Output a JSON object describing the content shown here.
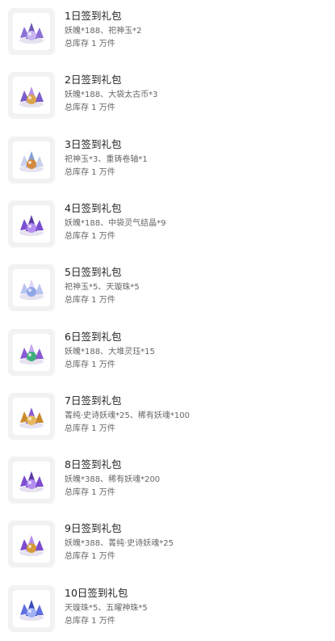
{
  "gifts": [
    {
      "title": "1日签到礼包",
      "desc": "妖魄*188、祀神玉*2",
      "stock": "总库存 1 万件",
      "icon": "purple-crystal-bundle-icon",
      "colors": [
        "#8e6fd6",
        "#c7b6f2",
        "#6d5bb8"
      ]
    },
    {
      "title": "2日签到礼包",
      "desc": "妖魄*188、大袋太古币*3",
      "stock": "总库存 1 万件",
      "icon": "purple-crystal-coin-bag-icon",
      "colors": [
        "#7e5cc9",
        "#d9a54a",
        "#b592e6"
      ]
    },
    {
      "title": "3日签到礼包",
      "desc": "祀神玉*3、重铸卷轴*1",
      "stock": "总库存 1 万件",
      "icon": "jade-scroll-bundle-icon",
      "colors": [
        "#c6d2ea",
        "#d48a3e",
        "#7fa0d8"
      ]
    },
    {
      "title": "4日签到礼包",
      "desc": "妖魄*188、中袋灵气结晶*9",
      "stock": "总库存 1 万件",
      "icon": "purple-crystal-pouch-icon",
      "colors": [
        "#7a4fd0",
        "#b48df0",
        "#5a3aa6"
      ]
    },
    {
      "title": "5日签到礼包",
      "desc": "祀神玉*5、天璇珠*5",
      "stock": "总库存 1 万件",
      "icon": "jade-pearl-bundle-icon",
      "colors": [
        "#b9c4f0",
        "#8fa6e8",
        "#e0d6f7"
      ]
    },
    {
      "title": "6日签到礼包",
      "desc": "妖魄*188、大堆灵珏*15",
      "stock": "总库存 1 万件",
      "icon": "purple-green-crystal-icon",
      "colors": [
        "#8a5ad6",
        "#3fae7a",
        "#c3a8f0"
      ]
    },
    {
      "title": "7日签到礼包",
      "desc": "菁纯·史诗妖魂*25、稀有妖魂*100",
      "stock": "总库存 1 万件",
      "icon": "golden-soul-orb-icon",
      "colors": [
        "#c98a2e",
        "#e6b85a",
        "#8a5ad6"
      ]
    },
    {
      "title": "8日签到礼包",
      "desc": "妖魄*388、稀有妖魂*200",
      "stock": "总库存 1 万件",
      "icon": "purple-crystal-pile-icon",
      "colors": [
        "#7d4ccf",
        "#b38cf2",
        "#5c3aa8"
      ]
    },
    {
      "title": "9日签到礼包",
      "desc": "妖魄*388、菁纯·史诗妖魂*25",
      "stock": "总库存 1 万件",
      "icon": "purple-crystal-gold-orb-icon",
      "colors": [
        "#7d4ccf",
        "#d59a3a",
        "#b38cf2"
      ]
    },
    {
      "title": "10日签到礼包",
      "desc": "天璇珠*5、五曜神珠*5",
      "stock": "总库存 1 万件",
      "icon": "blue-pearl-bundle-icon",
      "colors": [
        "#5f6fe0",
        "#9fb0f5",
        "#3a48b8"
      ]
    }
  ]
}
